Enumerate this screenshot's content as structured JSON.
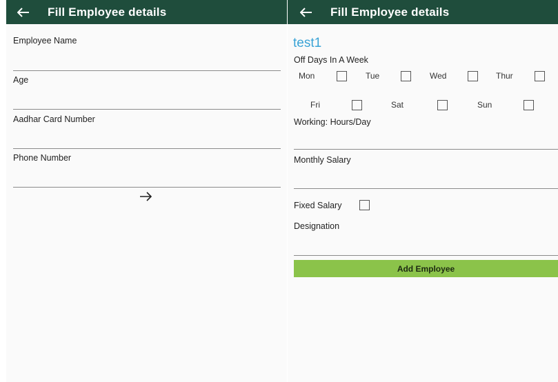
{
  "left_screen": {
    "appbar": {
      "title": "Fill Employee details",
      "back_icon": "arrow-left-icon"
    },
    "fields": {
      "employee_name": {
        "label": "Employee Name",
        "value": ""
      },
      "age": {
        "label": "Age",
        "value": ""
      },
      "aadhar": {
        "label": "Aadhar Card Number",
        "value": ""
      },
      "phone": {
        "label": "Phone Number",
        "value": ""
      }
    },
    "next_icon": "arrow-right-icon"
  },
  "right_screen": {
    "appbar": {
      "title": "Fill Employee details",
      "back_icon": "arrow-left-icon"
    },
    "employee_title": "test1",
    "off_days_label": "Off Days In A Week",
    "days": [
      "Mon",
      "Tue",
      "Wed",
      "Thur",
      "Fri",
      "Sat",
      "Sun"
    ],
    "fields": {
      "working_hours": {
        "label": "Working: Hours/Day",
        "value": ""
      },
      "monthly_salary": {
        "label": "Monthly Salary",
        "value": ""
      },
      "designation": {
        "label": "Designation",
        "value": ""
      }
    },
    "fixed_salary_label": "Fixed Salary",
    "add_button_label": "Add Employee"
  },
  "colors": {
    "appbar": "#1f4d3c",
    "title_accent": "#3aa3d6",
    "button": "#8bc34a"
  }
}
